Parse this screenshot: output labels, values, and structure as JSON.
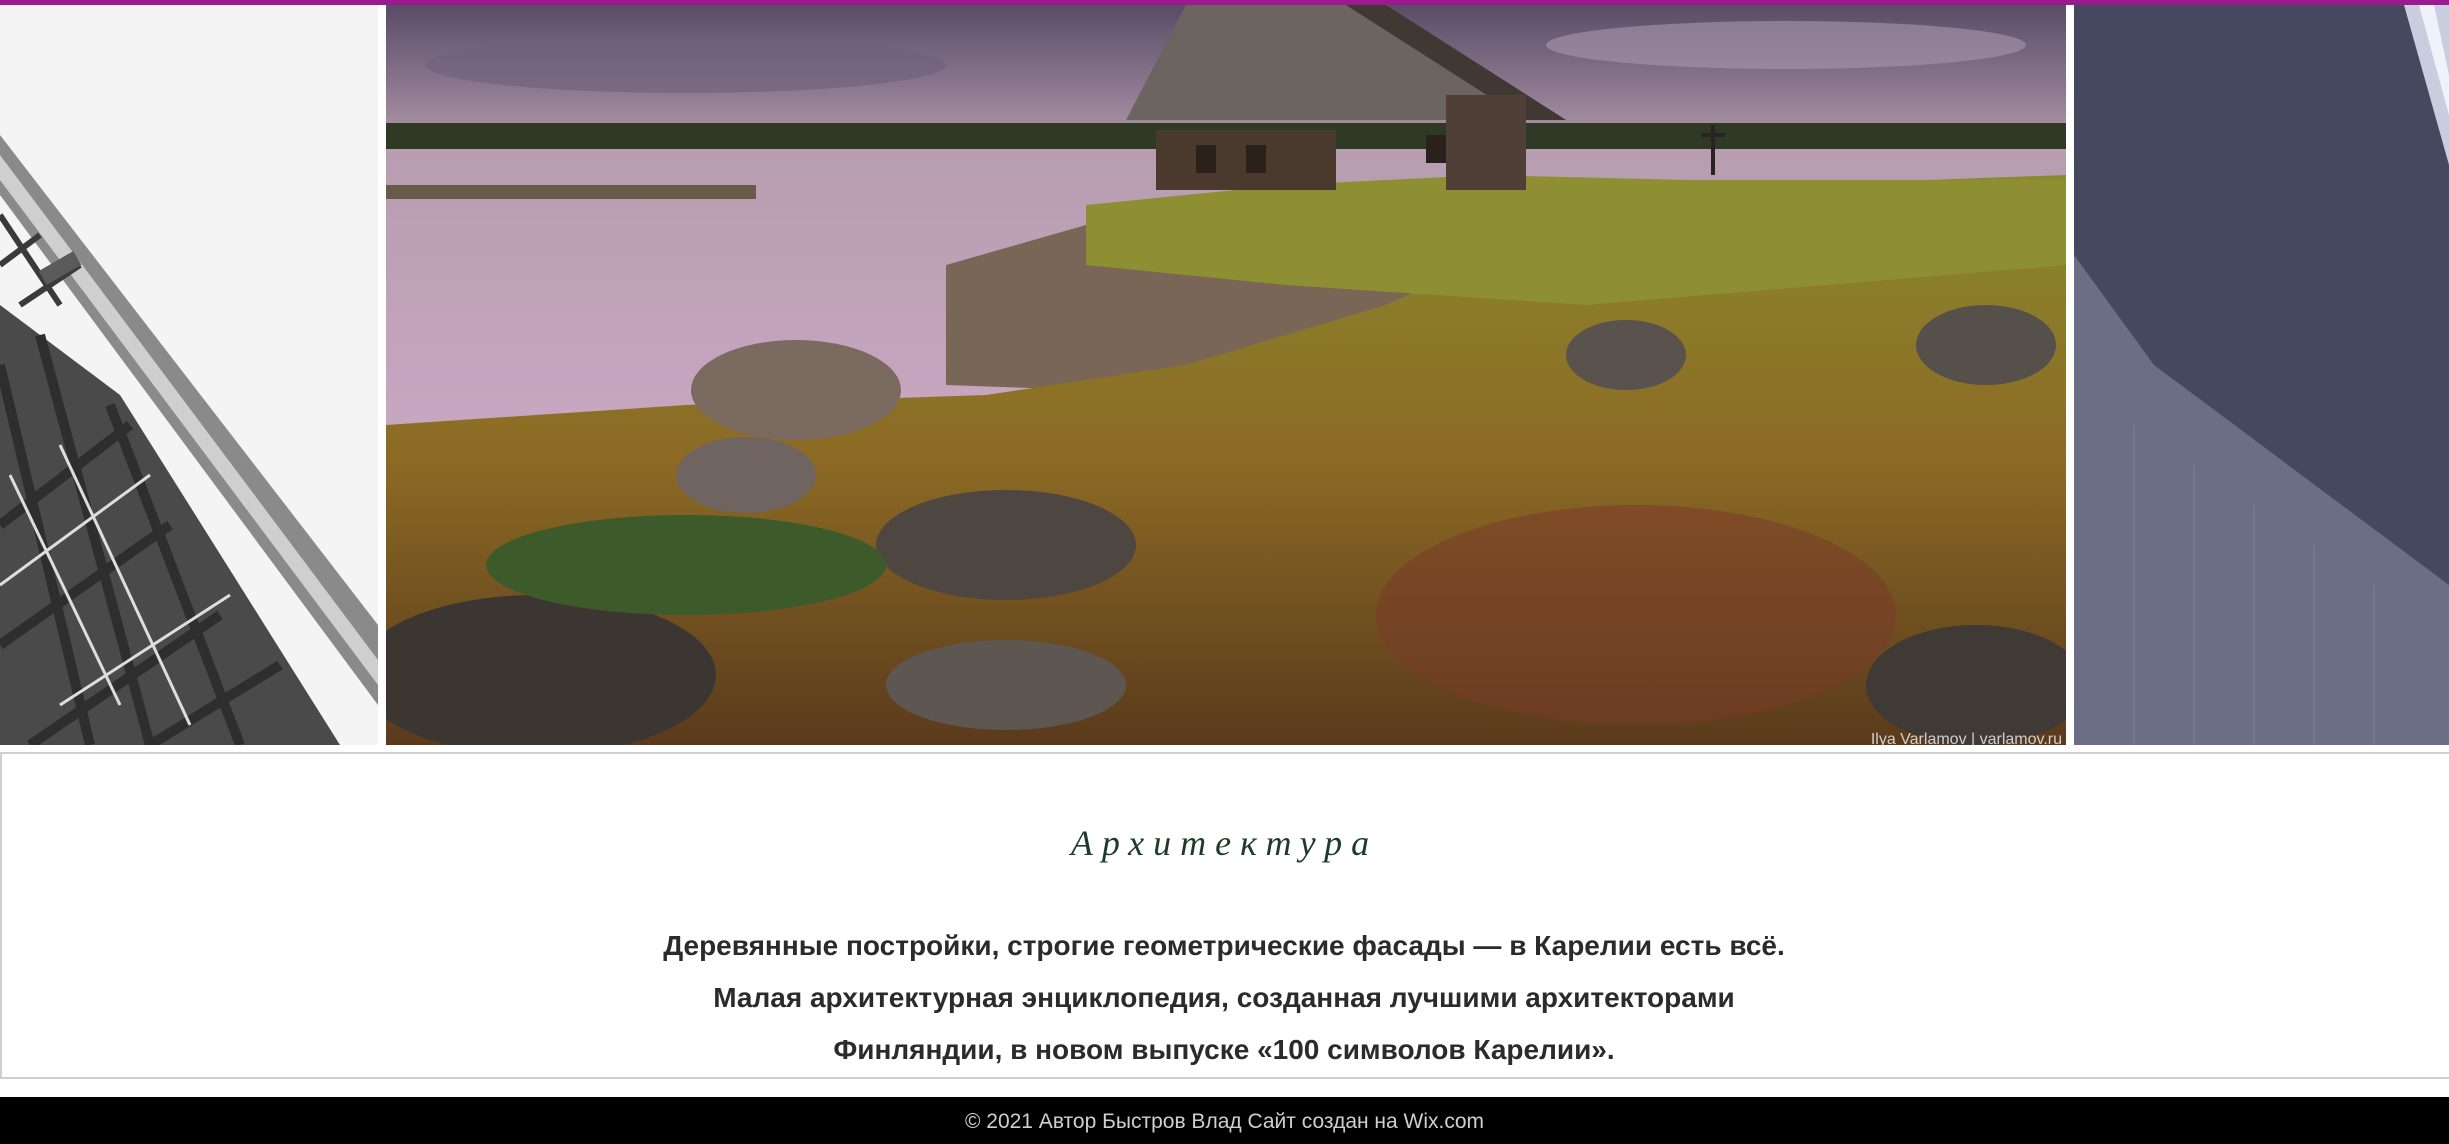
{
  "colors": {
    "accent": "#9b1a8f",
    "title": "#1d3a2c",
    "body_text": "#2b2b2b",
    "footer_bg": "#000000",
    "footer_text": "#cfcfcf"
  },
  "gallery": {
    "slides": [
      {
        "name": "steel-truss-photo"
      },
      {
        "name": "karelia-lake-house-photo",
        "credit": "Ilya Varlamov | varlamov.ru"
      },
      {
        "name": "dark-facade-photo"
      }
    ]
  },
  "section": {
    "title": "Архитектура",
    "lines": [
      "Деревянные постройки, строгие геометрические фасады — в Карелии есть всё.",
      "Малая архитектурная энциклопедия, созданная лучшими архитекторами",
      "Финляндии, в новом выпуске «100 символов Карелии»."
    ]
  },
  "footer": {
    "text": "© 2021 Автор Быстров Влад Сайт создан на Wix.com"
  }
}
